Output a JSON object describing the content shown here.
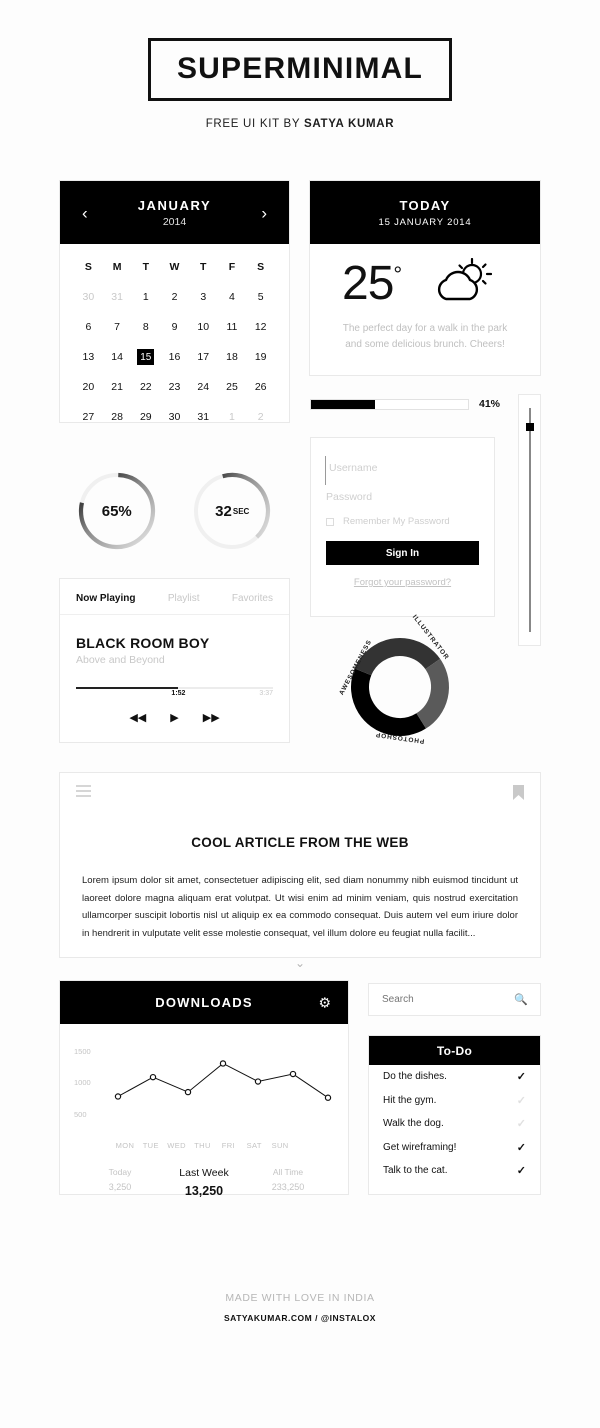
{
  "header": {
    "brand": "SUPERMINIMAL",
    "tagline_prefix": "FREE UI KIT BY ",
    "tagline_author": "SATYA KUMAR"
  },
  "calendar": {
    "month": "JANUARY",
    "year": "2014",
    "prev_icon": "chevron-left",
    "next_icon": "chevron-right",
    "dow": [
      "S",
      "M",
      "T",
      "W",
      "T",
      "F",
      "S"
    ],
    "weeks": [
      [
        {
          "d": "30",
          "muted": true
        },
        {
          "d": "31",
          "muted": true
        },
        {
          "d": "1"
        },
        {
          "d": "2"
        },
        {
          "d": "3"
        },
        {
          "d": "4"
        },
        {
          "d": "5"
        }
      ],
      [
        {
          "d": "6"
        },
        {
          "d": "7"
        },
        {
          "d": "8"
        },
        {
          "d": "9"
        },
        {
          "d": "10"
        },
        {
          "d": "11"
        },
        {
          "d": "12"
        }
      ],
      [
        {
          "d": "13"
        },
        {
          "d": "14"
        },
        {
          "d": "15",
          "selected": true
        },
        {
          "d": "16"
        },
        {
          "d": "17"
        },
        {
          "d": "18"
        },
        {
          "d": "19"
        }
      ],
      [
        {
          "d": "20"
        },
        {
          "d": "21"
        },
        {
          "d": "22"
        },
        {
          "d": "23"
        },
        {
          "d": "24"
        },
        {
          "d": "25"
        },
        {
          "d": "26"
        }
      ],
      [
        {
          "d": "27"
        },
        {
          "d": "28"
        },
        {
          "d": "29"
        },
        {
          "d": "30"
        },
        {
          "d": "31"
        },
        {
          "d": "1",
          "muted": true
        },
        {
          "d": "2",
          "muted": true
        }
      ]
    ]
  },
  "weather": {
    "title": "TODAY",
    "date": "15 JANUARY 2014",
    "temp": "25",
    "degree": "°",
    "icon": "sun-behind-cloud-icon",
    "description": "The perfect day for a walk in the park and some delicious brunch. Cheers!"
  },
  "progress": {
    "percent": 41,
    "label": "41%"
  },
  "slider": {
    "value_position_pct": 8
  },
  "login": {
    "username_placeholder": "Username",
    "password_placeholder": "Password",
    "remember_label": "Remember My Password",
    "signin_label": "Sign In",
    "forgot_label": "Forgot your password?"
  },
  "gauges": [
    {
      "name": "percent-gauge",
      "value": 65,
      "label": "65%",
      "unit": "",
      "arc_pct": 78
    },
    {
      "name": "seconds-gauge",
      "value": 32,
      "label": "32",
      "unit": "SEC",
      "arc_pct": 42
    }
  ],
  "music": {
    "tabs": [
      {
        "label": "Now Playing",
        "active": true
      },
      {
        "label": "Playlist",
        "active": false
      },
      {
        "label": "Favorites",
        "active": false
      }
    ],
    "track_title": "BLACK ROOM BOY",
    "artist": "Above and Beyond",
    "current_time": "1:52",
    "duration": "3:37",
    "progress_pct": 52,
    "controls": {
      "prev": "◀◀",
      "play": "▶",
      "next": "▶▶"
    }
  },
  "donut": {
    "segments": [
      {
        "label": "PHOTOSHOP",
        "color": "#000000",
        "pct": 40
      },
      {
        "label": "ILLUSTRATOR",
        "color": "#333333",
        "pct": 34
      },
      {
        "label": "AWESOMENESS",
        "color": "#5a5a5a",
        "pct": 26
      }
    ]
  },
  "article": {
    "menu_icon": "hamburger-icon",
    "bookmark_icon": "bookmark-icon",
    "title": "COOL ARTICLE FROM THE WEB",
    "body": "Lorem ipsum dolor sit amet, consectetuer adipiscing elit, sed diam nonummy nibh euismod tincidunt ut laoreet dolore magna aliquam erat volutpat. Ut wisi enim ad minim veniam, quis nostrud exercitation ullamcorper suscipit lobortis nisl ut aliquip ex ea commodo consequat. Duis autem vel eum iriure dolor in hendrerit in vulputate velit esse molestie consequat, vel illum dolore eu feugiat nulla facilit...",
    "expand_icon": "chevron-down-icon"
  },
  "downloads": {
    "title": "DOWNLOADS",
    "settings_icon": "gear-icon",
    "stats": [
      {
        "key": "Today",
        "value": "3,250",
        "main": false
      },
      {
        "key": "Last Week",
        "value": "13,250",
        "main": true
      },
      {
        "key": "All Time",
        "value": "233,250",
        "main": false
      }
    ]
  },
  "chart_data": {
    "type": "line",
    "title": "DOWNLOADS",
    "categories": [
      "MON",
      "TUE",
      "WED",
      "THU",
      "FRI",
      "SAT",
      "SUN"
    ],
    "values": [
      790,
      1100,
      860,
      1320,
      1030,
      1150,
      770
    ],
    "yticks": [
      1500,
      1000,
      500
    ],
    "ylim": [
      300,
      1600
    ],
    "xlabel": "",
    "ylabel": "",
    "grid": false,
    "legend": false,
    "marker": "open-circle",
    "line_color": "#111111"
  },
  "search": {
    "placeholder": "Search",
    "icon": "search-icon"
  },
  "todo": {
    "title": "To-Do",
    "items": [
      {
        "label": "Do the dishes.",
        "done": true
      },
      {
        "label": "Hit the gym.",
        "done": false
      },
      {
        "label": "Walk the dog.",
        "done": false
      },
      {
        "label": "Get wireframing!",
        "done": true
      },
      {
        "label": "Talk to the cat.",
        "done": true
      }
    ],
    "check_glyph": "✓"
  },
  "footer": {
    "line1": "MADE WITH LOVE IN INDIA",
    "line2": "SATYAKUMAR.COM / @INSTALOX"
  },
  "colors": {
    "accent": "#000000",
    "muted": "#c4c4c4",
    "border": "#e9e9e9"
  }
}
